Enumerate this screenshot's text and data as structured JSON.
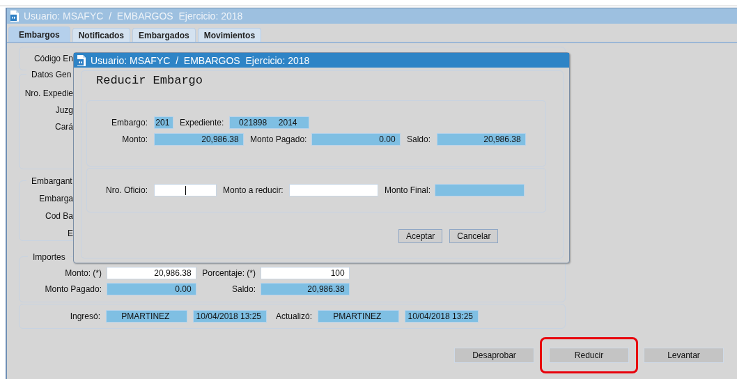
{
  "window": {
    "title": "Usuario: MSAFYC  /  EMBARGOS  Ejercicio: 2018",
    "active": false
  },
  "tabs": [
    {
      "label": "Embargos",
      "selected": true
    },
    {
      "label": "Notificados",
      "selected": false
    },
    {
      "label": "Embargados",
      "selected": false
    },
    {
      "label": "Movimientos",
      "selected": false
    }
  ],
  "codigo": {
    "label": "Código En"
  },
  "datos_generales": {
    "legend": "Datos Gen",
    "labels": [
      "Nro. Expedie",
      "Juzg",
      "Cará"
    ]
  },
  "embargante": {
    "legend": "Embargant",
    "labels": [
      "Embarga",
      "Cod Ba",
      "E"
    ]
  },
  "importes": {
    "legend": "Importes",
    "rows": [
      [
        {
          "kind": "label",
          "text": "Monto: (*)"
        },
        {
          "kind": "input",
          "value": "20,986.38"
        },
        {
          "kind": "label",
          "text": "Porcentaje: (*)"
        },
        {
          "kind": "input",
          "value": "100"
        }
      ],
      [
        {
          "kind": "label",
          "text": "Monto Pagado:"
        },
        {
          "kind": "display",
          "value": "0.00"
        },
        {
          "kind": "label",
          "text": "Saldo:"
        },
        {
          "kind": "display",
          "value": "20,986.38"
        }
      ]
    ]
  },
  "audit": {
    "rows": [
      [
        {
          "kind": "label",
          "text": "Ingresó:"
        },
        {
          "kind": "display",
          "value": "PMARTINEZ"
        },
        {
          "kind": "display",
          "value": "10/04/2018 13:25"
        },
        {
          "kind": "label",
          "text": "Actualizó:"
        },
        {
          "kind": "display",
          "value": "PMARTINEZ"
        },
        {
          "kind": "display",
          "value": "10/04/2018 13:25"
        }
      ]
    ]
  },
  "buttons": [
    {
      "label": "Desaprobar",
      "highlighted": false
    },
    {
      "label": "Reducir",
      "highlighted": true
    },
    {
      "label": "Levantar",
      "highlighted": false
    }
  ],
  "dialog": {
    "title": "Usuario: MSAFYC  /  EMBARGOS  Ejercicio: 2018",
    "active": true,
    "heading": "Reducir Embargo",
    "section_1": [
      [
        {
          "kind": "label",
          "text": "Embargo:"
        },
        {
          "kind": "display",
          "value": "201"
        },
        {
          "kind": "label",
          "text": "Expediente:"
        },
        {
          "kind": "display",
          "value": "021898     2014"
        }
      ],
      [
        {
          "kind": "label",
          "text": "Monto:"
        },
        {
          "kind": "display",
          "value": "20,986.38"
        },
        {
          "kind": "label",
          "text": "Monto Pagado:"
        },
        {
          "kind": "display",
          "value": "0.00"
        },
        {
          "kind": "label",
          "text": "Saldo:"
        },
        {
          "kind": "display",
          "value": "20,986.38"
        }
      ]
    ],
    "section_2": [
      [
        {
          "kind": "label",
          "text": "Nro. Oficio:"
        },
        {
          "kind": "input",
          "focused": true
        },
        {
          "kind": "label",
          "text": "Monto a reducir:"
        },
        {
          "kind": "input"
        },
        {
          "kind": "label",
          "text": "Monto Final:"
        },
        {
          "kind": "display"
        }
      ]
    ],
    "buttons": [
      {
        "label": "Aceptar"
      },
      {
        "label": "Cancelar"
      }
    ]
  }
}
